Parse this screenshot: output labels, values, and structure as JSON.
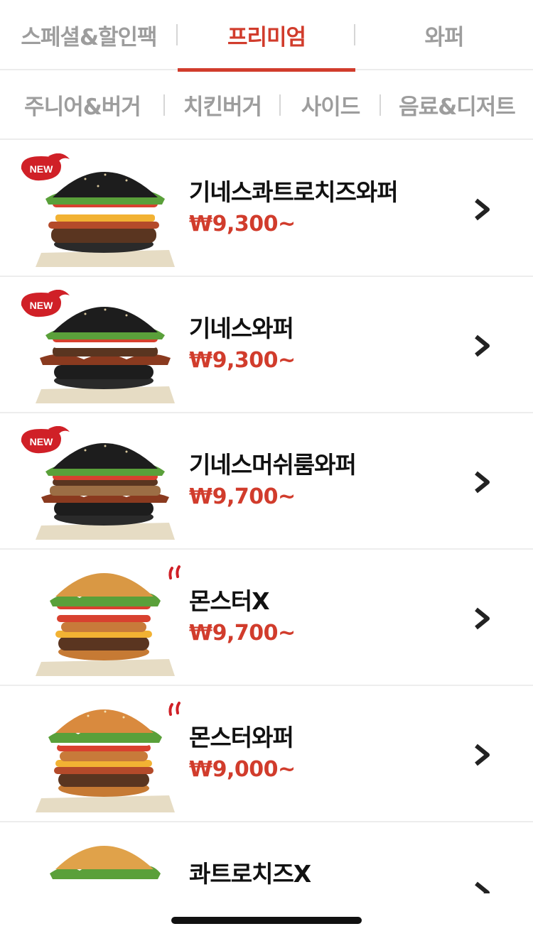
{
  "top_tabs": [
    {
      "label": "스페셜&할인팩"
    },
    {
      "label": "프리미엄"
    },
    {
      "label": "와퍼"
    }
  ],
  "sub_tabs": [
    {
      "label": "주니어&버거"
    },
    {
      "label": "치킨버거"
    },
    {
      "label": "사이드"
    },
    {
      "label": "음료&디저트"
    }
  ],
  "badges": {
    "new": "NEW"
  },
  "menu_items": [
    {
      "name": "기네스콰트로치즈와퍼",
      "price": "₩9,300~",
      "badge": "NEW",
      "bun": "black"
    },
    {
      "name": "기네스와퍼",
      "price": "₩9,300~",
      "badge": "NEW",
      "bun": "black"
    },
    {
      "name": "기네스머쉬룸와퍼",
      "price": "₩9,700~",
      "badge": "NEW",
      "bun": "black"
    },
    {
      "name": "몬스터X",
      "price": "₩9,700~",
      "badge": "spicy",
      "bun": "sesame"
    },
    {
      "name": "몬스터와퍼",
      "price": "₩9,000~",
      "badge": "spicy",
      "bun": "sesame"
    },
    {
      "name": "콰트로치즈X",
      "price": "",
      "badge": "",
      "bun": "plain"
    }
  ],
  "colors": {
    "accent": "#d13c2c",
    "muted": "#9d9d9d",
    "text": "#111111"
  }
}
